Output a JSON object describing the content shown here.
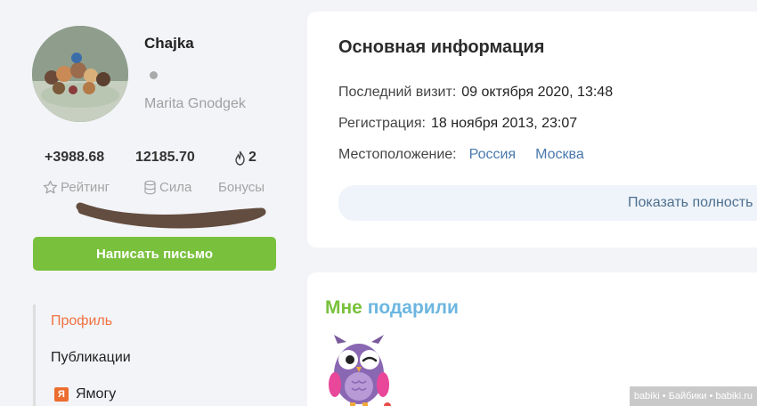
{
  "profile": {
    "username": "Chajka",
    "real_name": "Marita Gnodgek",
    "avatar_icon": "user-avatar-photo",
    "online_status_color": "#aaaaaa"
  },
  "stats": {
    "rating": {
      "value": "+3988.68",
      "label": "Рейтинг",
      "icon": "star-icon"
    },
    "power": {
      "value": "12185.70",
      "label": "Сила",
      "icon": "database-icon"
    },
    "bonus": {
      "value": "2",
      "label": "Бонусы",
      "icon": "flame-icon"
    }
  },
  "actions": {
    "write_letter": "Написать письмо"
  },
  "menu": {
    "items": [
      {
        "label": "Профиль",
        "active": true
      },
      {
        "label": "Публикации",
        "active": false
      },
      {
        "label": "Ямогу",
        "active": false,
        "badge": "Я"
      }
    ]
  },
  "info": {
    "title": "Основная информация",
    "last_visit_label": "Последний визит:",
    "last_visit_value": "09 октября 2020, 13:48",
    "registration_label": "Регистрация:",
    "registration_value": "18 ноября 2013, 23:07",
    "location_label": "Местоположение:",
    "country": "Россия",
    "city": "Москва",
    "show_full": "Показать полность"
  },
  "gifts": {
    "title_part1": "Мне",
    "title_part2": "подарили",
    "gift_icon": "owl-gift-icon"
  },
  "watermark": "babiki • Байбики • babiki.ru",
  "colors": {
    "accent_green": "#79c13c",
    "link_blue": "#4a79ad",
    "active_orange": "#f07240",
    "gifts_blue": "#6cb6e0",
    "background": "#f3f4f8"
  }
}
